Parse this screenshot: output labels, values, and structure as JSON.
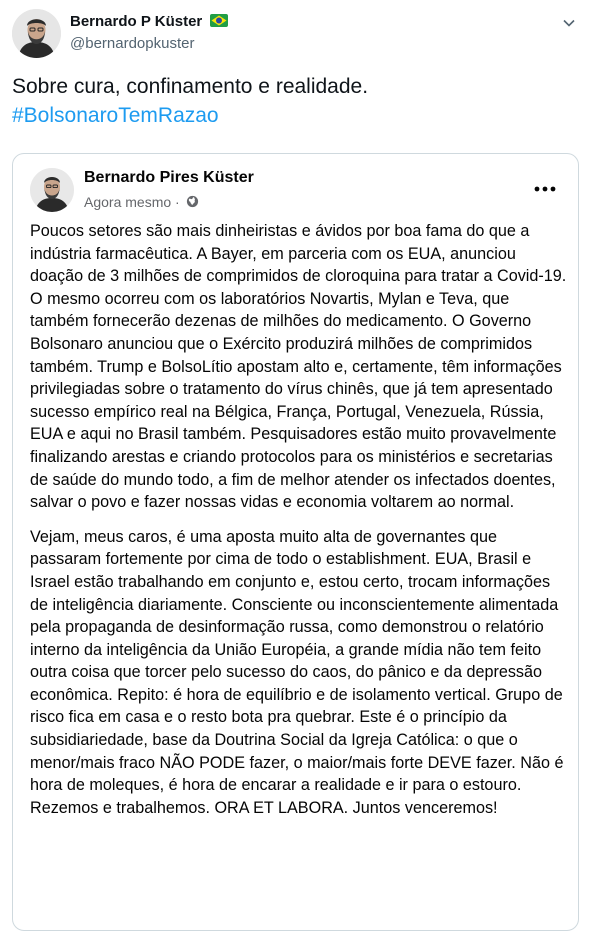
{
  "tweet": {
    "author_name": "Bernardo P Küster",
    "author_handle": "@bernardopkuster",
    "text": "Sobre cura, confinamento e realidade.",
    "hashtag": "#BolsonaroTemRazao"
  },
  "embedded_post": {
    "author_name": "Bernardo Pires Küster",
    "timestamp": "Agora mesmo",
    "separator": "·",
    "paragraphs": [
      "Poucos setores são mais dinheiristas e ávidos por boa fama do que a indústria farmacêutica. A Bayer, em parceria com os EUA, anunciou doação de 3 milhões de comprimidos de cloroquina para tratar a Covid-19. O mesmo ocorreu com os laboratórios Novartis, Mylan e Teva, que também fornecerão dezenas de milhões do medicamento. O Governo Bolsonaro anunciou que o Exército produzirá milhões de comprimidos também. Trump e BolsoLítio apostam alto e, certamente, têm informações privilegiadas sobre o tratamento do vírus chinês, que já tem apresentado sucesso empírico real na Bélgica, França, Portugal, Venezuela, Rússia, EUA e aqui no Brasil também. Pesquisadores estão muito provavelmente finalizando arestas e criando protocolos para os ministérios e secretarias de saúde do mundo todo, a fim de melhor atender os infectados doentes, salvar o povo e fazer nossas vidas e economia voltarem ao normal.",
      "Vejam, meus caros, é uma aposta muito alta de governantes que passaram fortemente por cima de todo o establishment. EUA, Brasil e Israel estão trabalhando em conjunto e, estou certo, trocam informações de inteligência diariamente. Consciente ou inconscientemente alimentada pela propaganda de desinformação russa, como demonstrou o relatório interno da inteligência da União Européia, a grande mídia não tem feito outra coisa que torcer pelo sucesso do caos, do pânico e da depressão econômica. Repito: é hora de equilíbrio e de isolamento vertical. Grupo de risco fica em casa e o resto bota pra quebrar. Este é o princípio da subsidiariedade, base da Doutrina Social da Igreja Católica: o que o menor/mais fraco NÃO PODE fazer, o maior/mais forte DEVE fazer. Não é hora de moleques, é hora de encarar a realidade e ir para o estouro. Rezemos e trabalhemos. ORA ET LABORA. Juntos venceremos!"
    ]
  },
  "icons": {
    "flag": "brazil-flag-icon",
    "caret": "chevron-down-icon",
    "globe": "globe-icon",
    "more": "more-horizontal-icon"
  }
}
